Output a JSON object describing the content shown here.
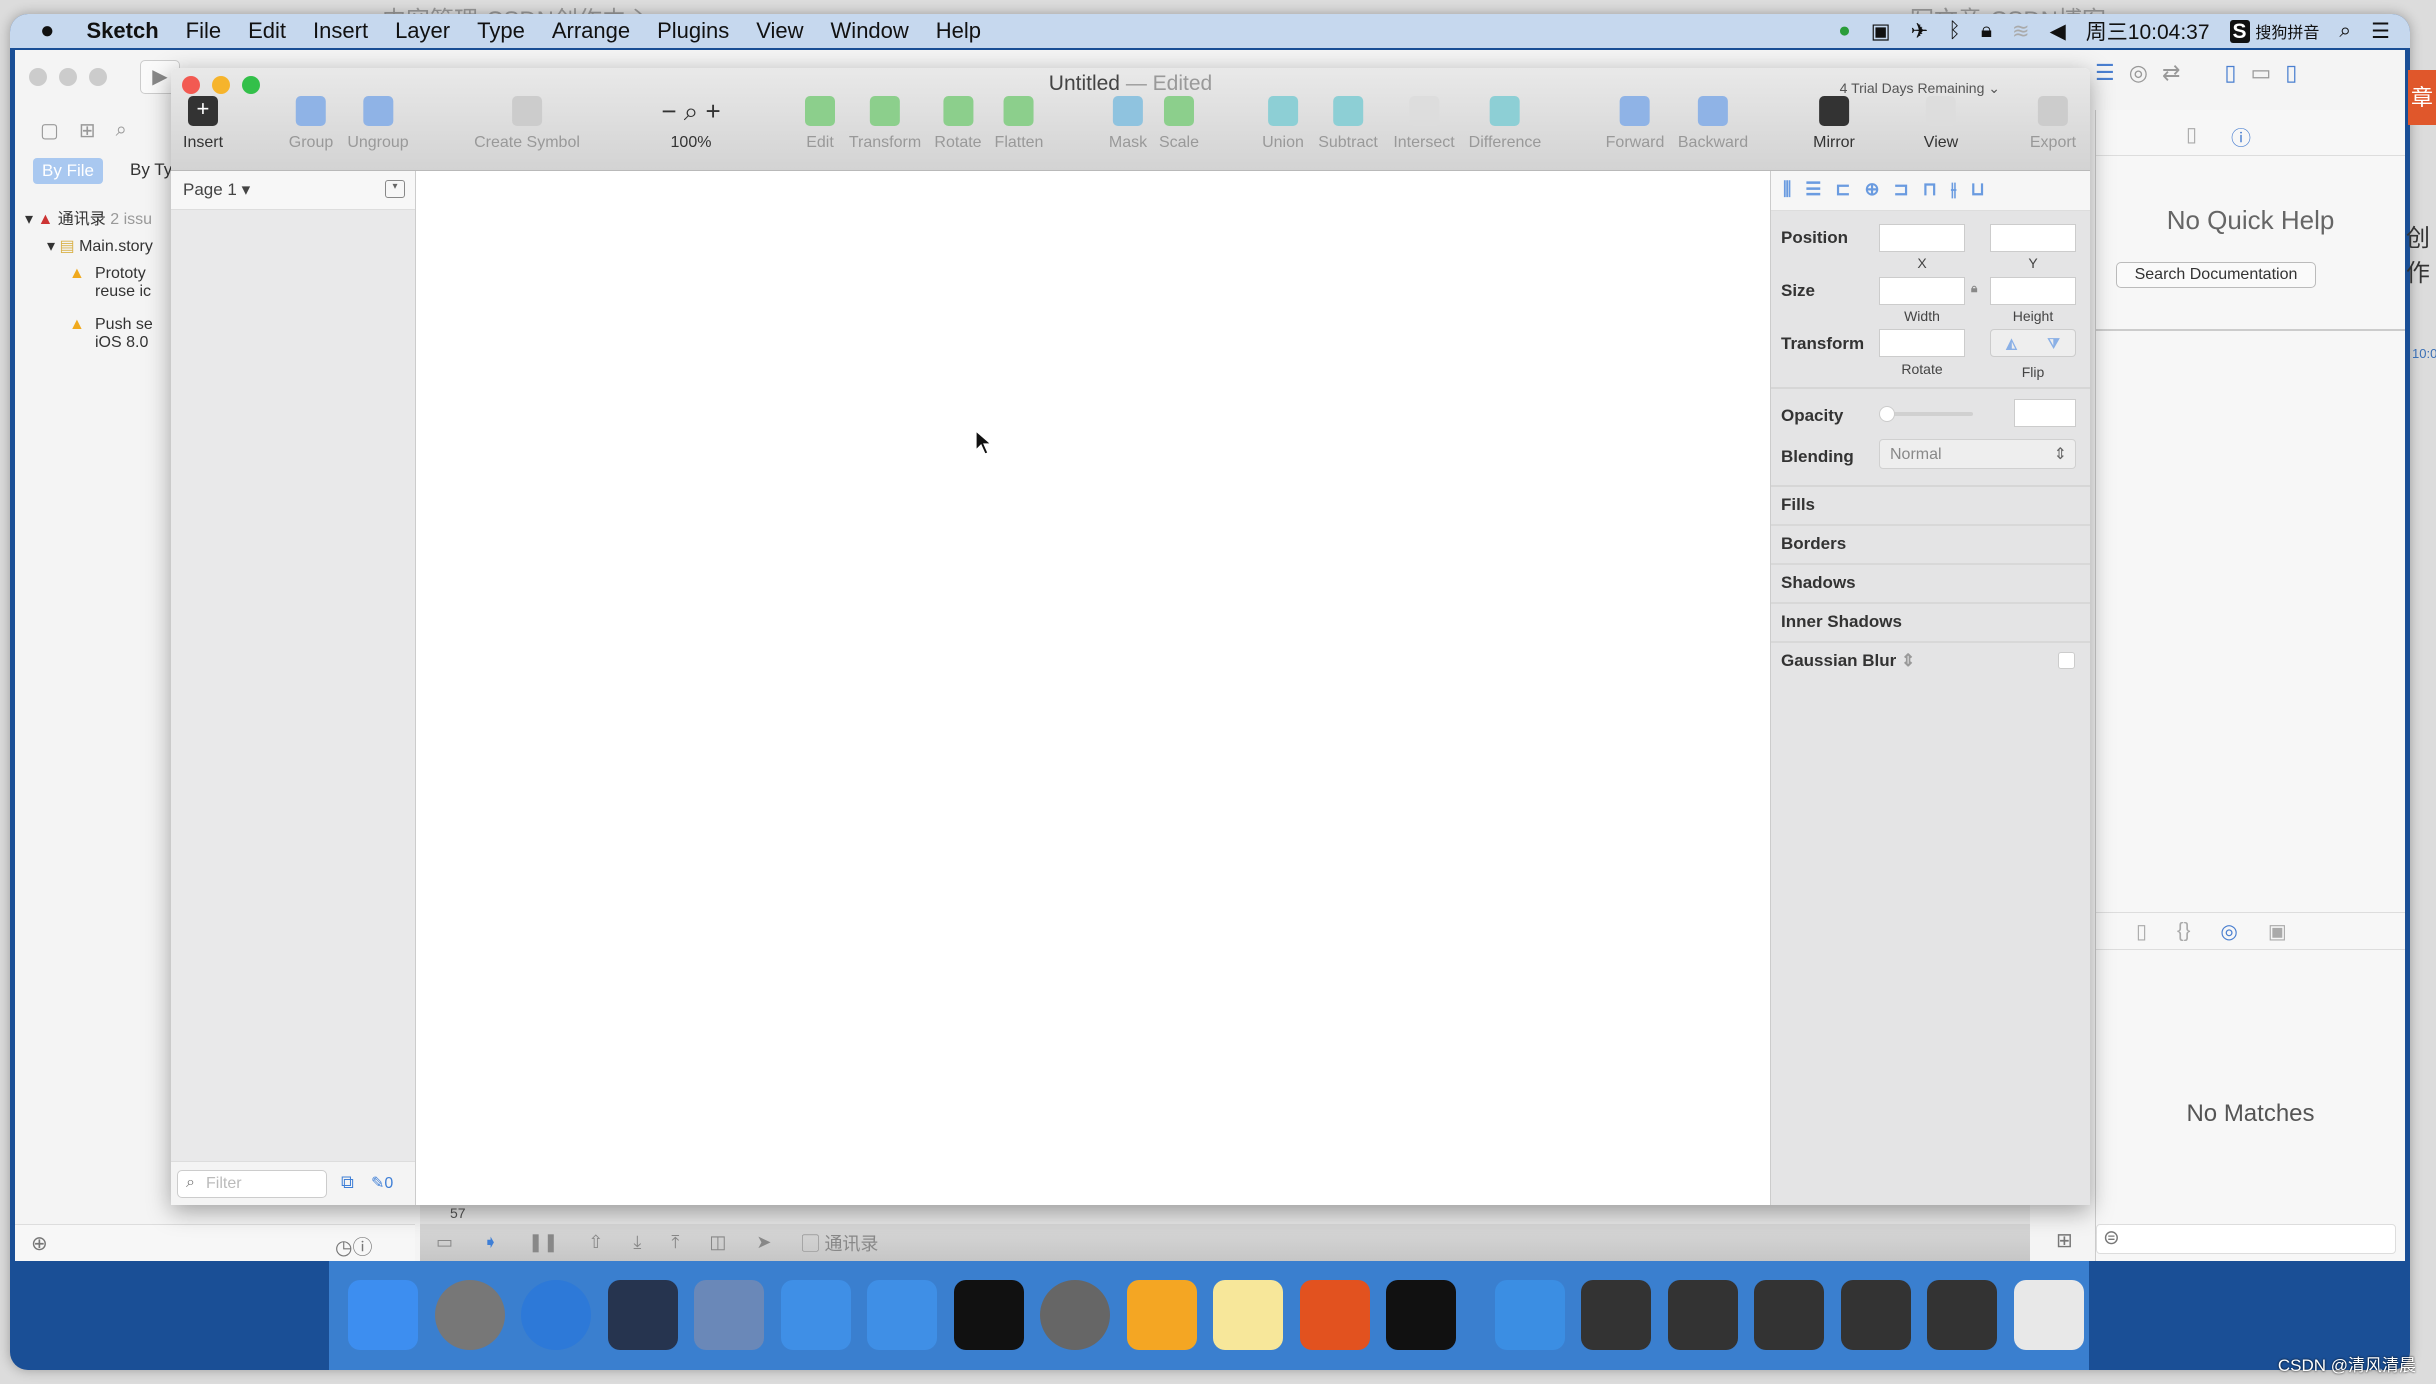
{
  "background_tabs": [
    "内容管理-CSDN创作中心",
    "写文章-CSDN博客"
  ],
  "menubar": {
    "app": "Sketch",
    "items": [
      "File",
      "Edit",
      "Insert",
      "Layer",
      "Type",
      "Arrange",
      "Plugins",
      "View",
      "Window",
      "Help"
    ],
    "clock": "周三10:04:37",
    "input_method": "搜狗拼音"
  },
  "xcode": {
    "nav_tabs": [
      "By File",
      "By Ty"
    ],
    "tree": [
      {
        "label": "通讯录",
        "extra": "2 issu"
      },
      {
        "label": "Main.story"
      },
      {
        "label": "Prototy",
        "line2": "reuse ic"
      },
      {
        "label": "Push se",
        "line2": "iOS 8.0"
      }
    ],
    "quick_help": "No Quick Help",
    "search_doc": "Search Documentation",
    "no_matches": "No Matches",
    "debug_label": "57",
    "scheme": "通讯录"
  },
  "sketch": {
    "title": "Untitled",
    "edited": "— Edited",
    "trial": "4 Trial Days Remaining",
    "toolbar": [
      "Insert",
      "Group",
      "Ungroup",
      "Create Symbol",
      "100%",
      "Edit",
      "Transform",
      "Rotate",
      "Flatten",
      "Mask",
      "Scale",
      "Union",
      "Subtract",
      "Intersect",
      "Difference",
      "Forward",
      "Backward",
      "Mirror",
      "View",
      "Export"
    ],
    "page": "Page 1",
    "filter_placeholder": "Filter",
    "slice_count": "0",
    "inspector": {
      "position": "Position",
      "x": "X",
      "y": "Y",
      "size": "Size",
      "width": "Width",
      "height": "Height",
      "transform": "Transform",
      "rotate": "Rotate",
      "flip": "Flip",
      "opacity": "Opacity",
      "opacity_value": 0,
      "blending": "Blending",
      "blending_value": "Normal",
      "sections": [
        "Fills",
        "Borders",
        "Shadows",
        "Inner Shadows",
        "Gaussian Blur"
      ]
    }
  },
  "side_fragments": [
    "章",
    "创作",
    "10:0"
  ],
  "watermark": "CSDN @清风清晨",
  "dock": [
    "finder",
    "launchpad",
    "safari",
    "mouse",
    "photo-booth",
    "xcode",
    "simulator",
    "terminal",
    "system-preferences",
    "sketch",
    "notes",
    "powerpoint",
    "console",
    "quicktime",
    "window-1",
    "window-2",
    "window-3",
    "window-4",
    "window-5",
    "trash"
  ],
  "colors": {
    "menubar": "#c6d8ee",
    "dock": "#3a7fcf",
    "accent": "#4a90e2"
  }
}
